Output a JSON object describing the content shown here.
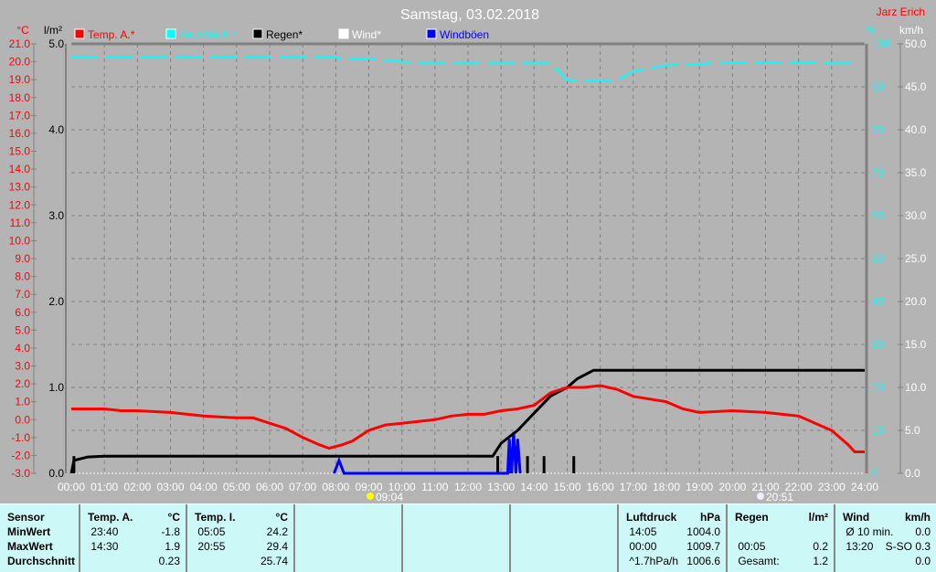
{
  "chart_data": {
    "type": "line",
    "title": "Samstag, 03.02.2018",
    "owner": "Jarz Erich",
    "legend": [
      {
        "name": "Temp. A.*",
        "color": "#ff0000"
      },
      {
        "name": "Feuchte A.*",
        "color": "#00ffff"
      },
      {
        "name": "Regen*",
        "color": "#000000"
      },
      {
        "name": "Wind*",
        "color": "#ffffff"
      },
      {
        "name": "Windböen",
        "color": "#0000ff"
      }
    ],
    "axes": {
      "temp": {
        "label": "°C",
        "range": [
          -3,
          21
        ],
        "step": 1
      },
      "rain": {
        "label": "l/m²",
        "range": [
          0,
          5
        ],
        "step": 1
      },
      "humidity": {
        "label": "%",
        "range": [
          0,
          100
        ],
        "step": 10
      },
      "wind": {
        "label": "km/h",
        "range": [
          0,
          50
        ],
        "step": 5
      },
      "x": {
        "range": [
          0,
          24
        ],
        "ticks": [
          "00:00",
          "01:00",
          "02:00",
          "03:00",
          "04:00",
          "05:00",
          "06:00",
          "07:00",
          "08:00",
          "09:00",
          "10:00",
          "11:00",
          "12:00",
          "13:00",
          "14:00",
          "15:00",
          "16:00",
          "17:00",
          "18:00",
          "19:00",
          "20:00",
          "21:00",
          "22:00",
          "23:00",
          "24:00"
        ]
      }
    },
    "sunrise": "09:04",
    "sunset": "20:51",
    "series": {
      "temp": [
        [
          0,
          0.6
        ],
        [
          1,
          0.6
        ],
        [
          1.5,
          0.5
        ],
        [
          2,
          0.5
        ],
        [
          3,
          0.4
        ],
        [
          4,
          0.2
        ],
        [
          5,
          0.1
        ],
        [
          5.5,
          0.1
        ],
        [
          6,
          -0.2
        ],
        [
          6.5,
          -0.5
        ],
        [
          7,
          -1.0
        ],
        [
          7.5,
          -1.4
        ],
        [
          7.8,
          -1.6
        ],
        [
          8.2,
          -1.4
        ],
        [
          8.5,
          -1.2
        ],
        [
          9,
          -0.6
        ],
        [
          9.5,
          -0.3
        ],
        [
          10,
          -0.2
        ],
        [
          11,
          0
        ],
        [
          11.5,
          0.2
        ],
        [
          12,
          0.3
        ],
        [
          12.5,
          0.3
        ],
        [
          13,
          0.5
        ],
        [
          13.5,
          0.6
        ],
        [
          14,
          0.8
        ],
        [
          14.5,
          1.5
        ],
        [
          15,
          1.8
        ],
        [
          15.5,
          1.8
        ],
        [
          16,
          1.9
        ],
        [
          16.5,
          1.7
        ],
        [
          17,
          1.3
        ],
        [
          18,
          1.0
        ],
        [
          18.5,
          0.6
        ],
        [
          19,
          0.4
        ],
        [
          20,
          0.5
        ],
        [
          21,
          0.4
        ],
        [
          22,
          0.2
        ],
        [
          22.5,
          -0.2
        ],
        [
          23,
          -0.6
        ],
        [
          23.5,
          -1.4
        ],
        [
          23.7,
          -1.8
        ],
        [
          24,
          -1.8
        ]
      ],
      "humidity": [
        [
          0,
          97
        ],
        [
          8,
          97
        ],
        [
          8.1,
          96.5
        ],
        [
          9,
          96.5
        ],
        [
          10.5,
          95.5
        ],
        [
          11.5,
          95.5
        ],
        [
          13.5,
          95.5
        ],
        [
          14.5,
          95.5
        ],
        [
          15,
          91.5
        ],
        [
          16.5,
          91.5
        ],
        [
          17,
          93.6
        ],
        [
          18,
          95
        ],
        [
          20,
          95.7
        ],
        [
          23,
          95.5
        ],
        [
          23.8,
          95.5
        ]
      ],
      "rain_total": [
        [
          0,
          0
        ],
        [
          0.08,
          0.15
        ],
        [
          0.5,
          0.19
        ],
        [
          1,
          0.2
        ],
        [
          12.75,
          0.2
        ],
        [
          13,
          0.35
        ],
        [
          13.5,
          0.5
        ],
        [
          14,
          0.7
        ],
        [
          14.5,
          0.9
        ],
        [
          15,
          1.0
        ],
        [
          15.3,
          1.1
        ],
        [
          15.8,
          1.2
        ],
        [
          24,
          1.2
        ]
      ],
      "rain_bars": [
        [
          0.08,
          0.2
        ],
        [
          12.9,
          0.2
        ],
        [
          13.25,
          0.2
        ],
        [
          13.8,
          0.2
        ],
        [
          14.3,
          0.2
        ],
        [
          15.2,
          0.2
        ]
      ],
      "gusts": [
        [
          7.95,
          0
        ],
        [
          8.1,
          1.5
        ],
        [
          8.25,
          0
        ],
        [
          13.2,
          0
        ],
        [
          13.25,
          4.0
        ],
        [
          13.32,
          0
        ],
        [
          13.38,
          4.8
        ],
        [
          13.45,
          0
        ],
        [
          13.5,
          4.0
        ],
        [
          13.58,
          0
        ]
      ]
    }
  },
  "panel": {
    "sensor": {
      "h": "Sensor",
      "r": [
        "MinWert",
        "MaxWert",
        "Durchschnitt"
      ]
    },
    "tempA": {
      "h": "Temp. A.",
      "u": "°C",
      "r": [
        [
          "23:40",
          "-1.8"
        ],
        [
          "14:30",
          "1.9"
        ],
        [
          "",
          "0.23"
        ]
      ]
    },
    "tempI": {
      "h": "Temp. I.",
      "u": "°C",
      "r": [
        [
          "05:05",
          "24.2"
        ],
        [
          "20:55",
          "29.4"
        ],
        [
          "",
          "25.74"
        ]
      ]
    },
    "druck": {
      "h": "Luftdruck",
      "u": "hPa",
      "r": [
        [
          "14:05",
          "1004.0"
        ],
        [
          "00:00",
          "1009.7"
        ],
        [
          "^1.7hPa/h",
          "1006.6"
        ]
      ]
    },
    "regen": {
      "h": "Regen",
      "u": "l/m²",
      "r": [
        [
          "",
          ""
        ],
        [
          "00:05",
          "0.2"
        ],
        [
          "Gesamt:",
          "1.2"
        ]
      ]
    },
    "wind": {
      "h": "Wind",
      "u": "km/h",
      "r": [
        [
          "Ø 10 min.",
          "0.0"
        ],
        [
          "13:20",
          "S-SO 0.3"
        ],
        [
          "",
          "0.0"
        ]
      ]
    }
  }
}
